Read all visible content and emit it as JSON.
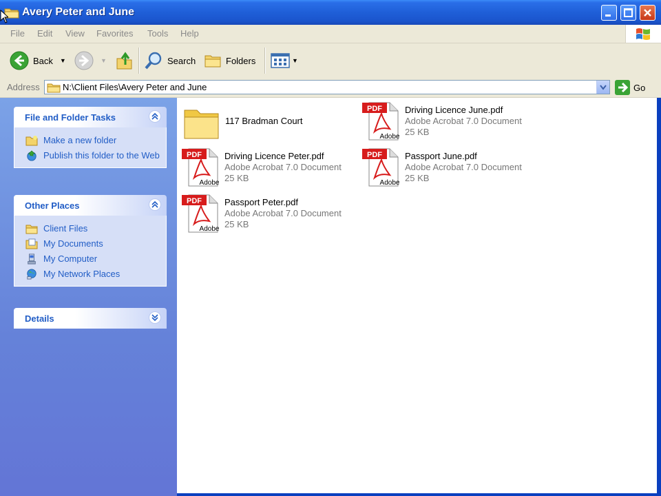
{
  "window": {
    "title": "Avery Peter and June"
  },
  "menu": [
    "File",
    "Edit",
    "View",
    "Favorites",
    "Tools",
    "Help"
  ],
  "toolbar": {
    "back_label": "Back",
    "search_label": "Search",
    "folders_label": "Folders"
  },
  "address": {
    "label": "Address",
    "value": "N:\\Client Files\\Avery Peter and June",
    "go_label": "Go"
  },
  "left_pane": {
    "file_tasks": {
      "title": "File and Folder Tasks",
      "items": [
        "Make a new folder",
        "Publish this folder to the Web"
      ]
    },
    "other_places": {
      "title": "Other Places",
      "items": [
        "Client Files",
        "My Documents",
        "My Computer",
        "My Network Places"
      ]
    },
    "details": {
      "title": "Details"
    }
  },
  "files": [
    {
      "name": "117 Bradman Court",
      "kind": "folder"
    },
    {
      "name": "Driving Licence June.pdf",
      "type": "Adobe Acrobat 7.0 Document",
      "size": "25 KB"
    },
    {
      "name": "Driving Licence Peter.pdf",
      "type": "Adobe Acrobat 7.0 Document",
      "size": "25 KB"
    },
    {
      "name": "Passport June.pdf",
      "type": "Adobe Acrobat 7.0 Document",
      "size": "25 KB"
    },
    {
      "name": "Passport Peter.pdf",
      "type": "Adobe Acrobat 7.0 Document",
      "size": "25 KB"
    }
  ],
  "pdf_icon": {
    "badge": "PDF",
    "brand": "Adobe"
  }
}
